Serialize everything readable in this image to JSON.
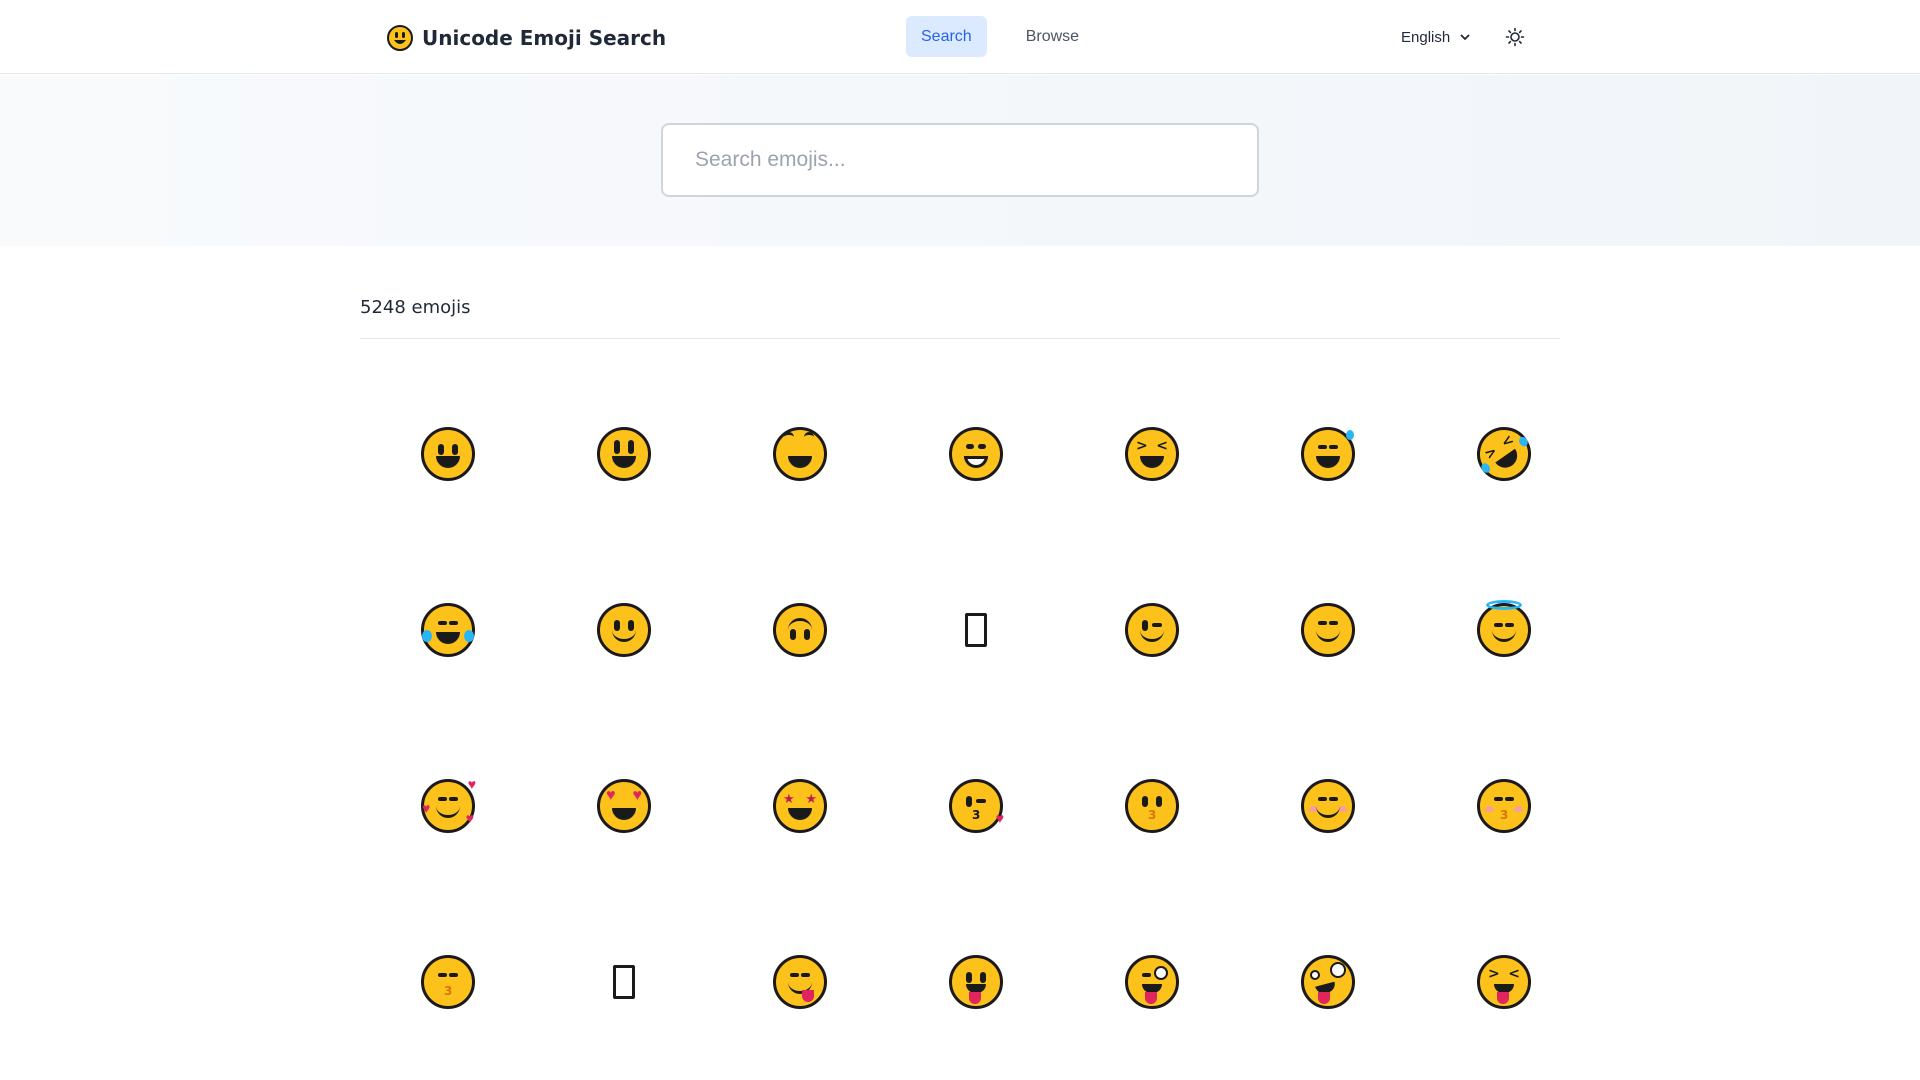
{
  "header": {
    "brand_title": "Unicode Emoji Search",
    "nav": [
      {
        "label": "Search",
        "active": true
      },
      {
        "label": "Browse",
        "active": false
      }
    ],
    "language": "English",
    "theme_icon": "sun-icon"
  },
  "search": {
    "placeholder": "Search emojis...",
    "value": ""
  },
  "results": {
    "count_label": "5248 emojis",
    "emojis": [
      "grinning-face",
      "grinning-face-with-big-eyes",
      "grinning-face-with-smiling-eyes",
      "beaming-face-with-smiling-eyes",
      "grinning-squinting-face",
      "grinning-face-with-sweat",
      "rolling-on-the-floor-laughing",
      "face-with-tears-of-joy",
      "slightly-smiling-face",
      "upside-down-face",
      "unsupported-glyph",
      "winking-face",
      "smiling-face-with-smiling-eyes",
      "smiling-face-with-halo",
      "smiling-face-with-hearts",
      "smiling-face-with-heart-eyes",
      "star-struck",
      "face-blowing-a-kiss",
      "kissing-face",
      "smiling-face",
      "kissing-face-with-closed-eyes",
      "kissing-face-with-smiling-eyes",
      "unsupported-glyph",
      "face-savoring-food",
      "face-with-tongue",
      "winking-face-with-tongue",
      "zany-face",
      "squinting-face-with-tongue"
    ]
  },
  "colors": {
    "accent": "#2563eb",
    "accent_bg": "#dbeafe",
    "emoji_yellow": "#fcc21b"
  }
}
